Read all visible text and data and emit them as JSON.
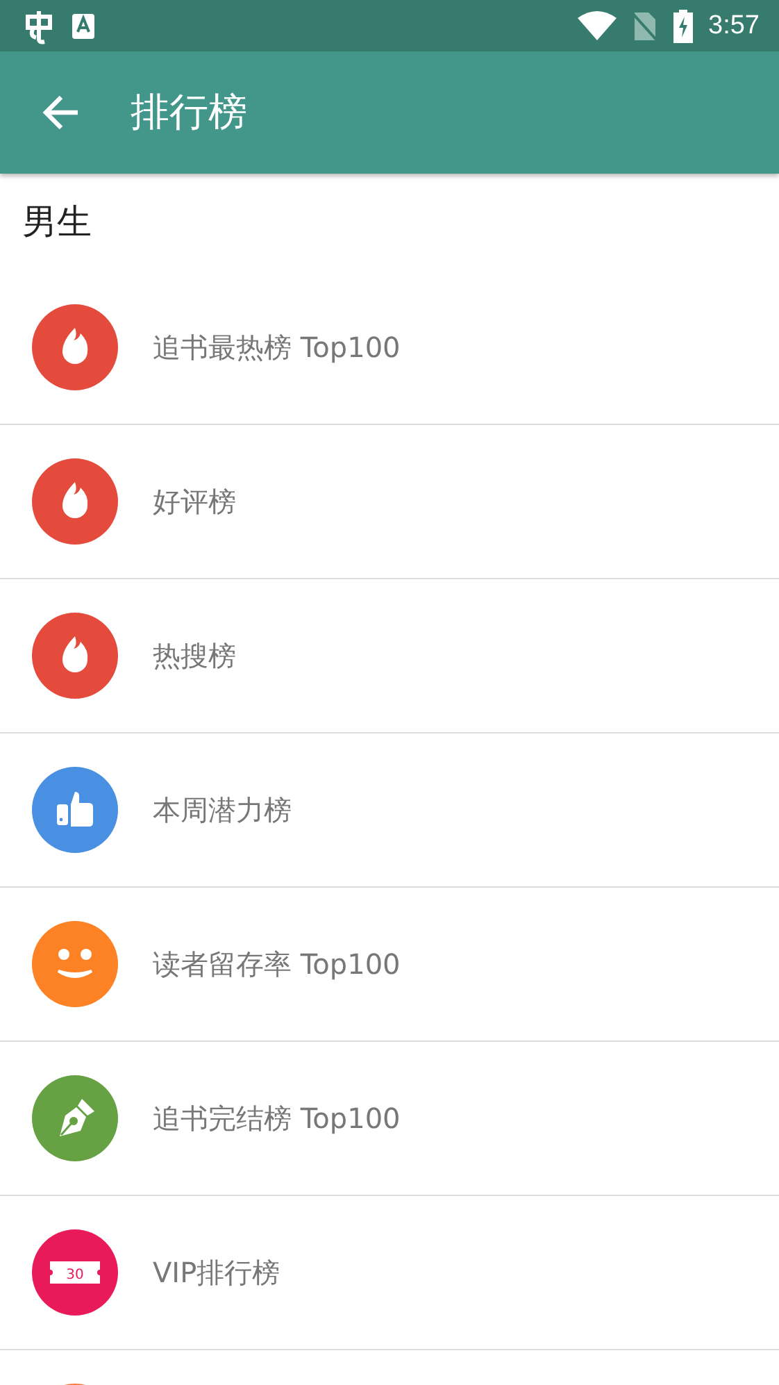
{
  "status_bar": {
    "time": "3:57"
  },
  "toolbar": {
    "title": "排行榜"
  },
  "section": {
    "title": "男生"
  },
  "items": [
    {
      "label": "追书最热榜 Top100",
      "kind": "fire",
      "color": "#e54b3c"
    },
    {
      "label": "好评榜",
      "kind": "fire",
      "color": "#e54b3c"
    },
    {
      "label": "热搜榜",
      "kind": "fire",
      "color": "#e54b3c"
    },
    {
      "label": "本周潜力榜",
      "kind": "thumb",
      "color": "#4a90e2"
    },
    {
      "label": "读者留存率 Top100",
      "kind": "smile",
      "color": "#fd8125"
    },
    {
      "label": "追书完结榜 Top100",
      "kind": "pen",
      "color": "#66a143"
    },
    {
      "label": "VIP排行榜",
      "kind": "ticket",
      "color": "#e91a5a",
      "icon_text": "30"
    },
    {
      "kind": "circle",
      "color": "#f97a3b"
    }
  ]
}
